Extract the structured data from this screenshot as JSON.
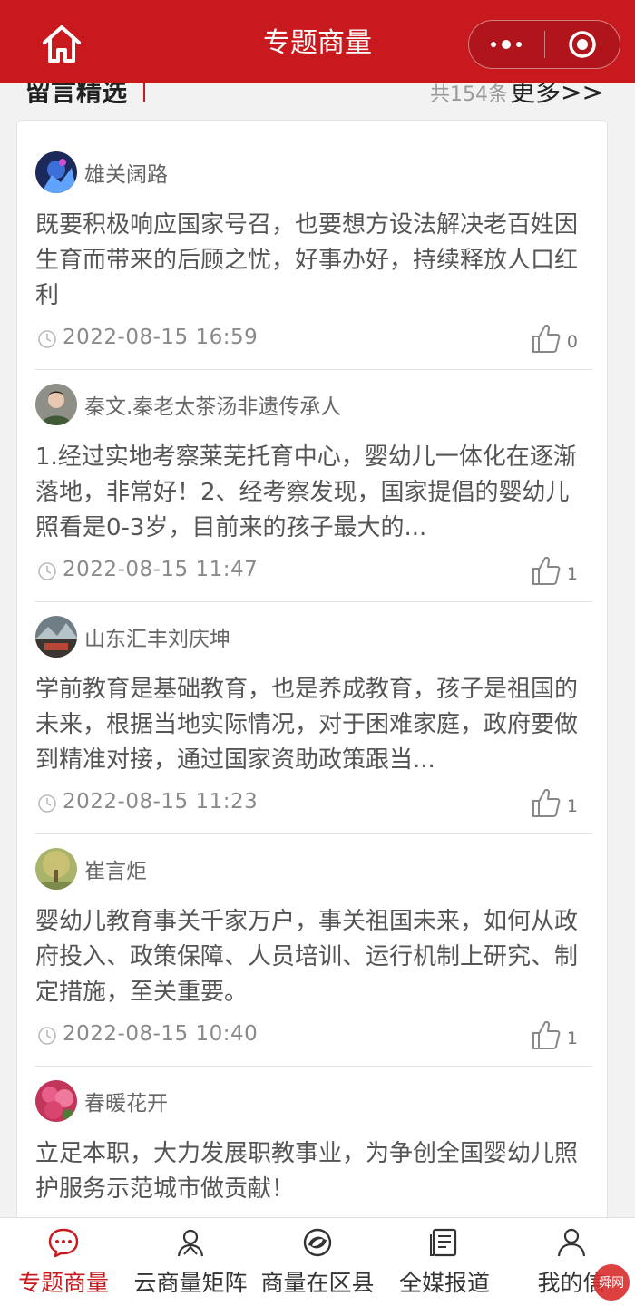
{
  "header": {
    "title": "专题商量"
  },
  "section": {
    "title": "留言精选",
    "count_text": "共154条",
    "more_label": "更多>>"
  },
  "comments": [
    {
      "user": "雄关阔路",
      "content": "既要积极响应国家号召，也要想方设法解决老百姓因生育而带来的后顾之忧，好事办好，持续释放人口红利",
      "time": "2022-08-15 16:59",
      "likes": "0"
    },
    {
      "user": "秦文.秦老太茶汤非遗传承人",
      "content": "1.经过实地考察莱芜托育中心，婴幼儿一体化在逐渐落地，非常好！2、经考察发现，国家提倡的婴幼儿照看是0-3岁，目前来的孩子最大的...",
      "time": "2022-08-15 11:47",
      "likes": "1"
    },
    {
      "user": "山东汇丰刘庆坤",
      "content": "学前教育是基础教育，也是养成教育，孩子是祖国的未来，根据当地实际情况，对于困难家庭，政府要做到精准对接，通过国家资助政策跟当...",
      "time": "2022-08-15 11:23",
      "likes": "1"
    },
    {
      "user": "崔言炬",
      "content": "婴幼儿教育事关千家万户，事关祖国未来，如何从政府投入、政策保障、人员培训、运行机制上研究、制定措施，至关重要。",
      "time": "2022-08-15 10:40",
      "likes": "1"
    },
    {
      "user": "春暖花开",
      "content": "立足本职，大力发展职教事业，为争创全国婴幼儿照护服务示范城市做贡献！",
      "time": "",
      "likes": ""
    }
  ],
  "nav": [
    {
      "label": "专题商量",
      "icon": "chat-bubble-icon",
      "active": true
    },
    {
      "label": "云商量矩阵",
      "icon": "people-icon",
      "active": false
    },
    {
      "label": "商量在区县",
      "icon": "swirl-icon",
      "active": false
    },
    {
      "label": "全媒报道",
      "icon": "document-icon",
      "active": false
    },
    {
      "label": "我的信",
      "icon": "user-icon",
      "active": false
    }
  ],
  "watermark": {
    "text": "舜网"
  },
  "colors": {
    "brand": "#c8191e",
    "card_bg": "#ffffff",
    "page_bg": "#f2f2f2"
  }
}
